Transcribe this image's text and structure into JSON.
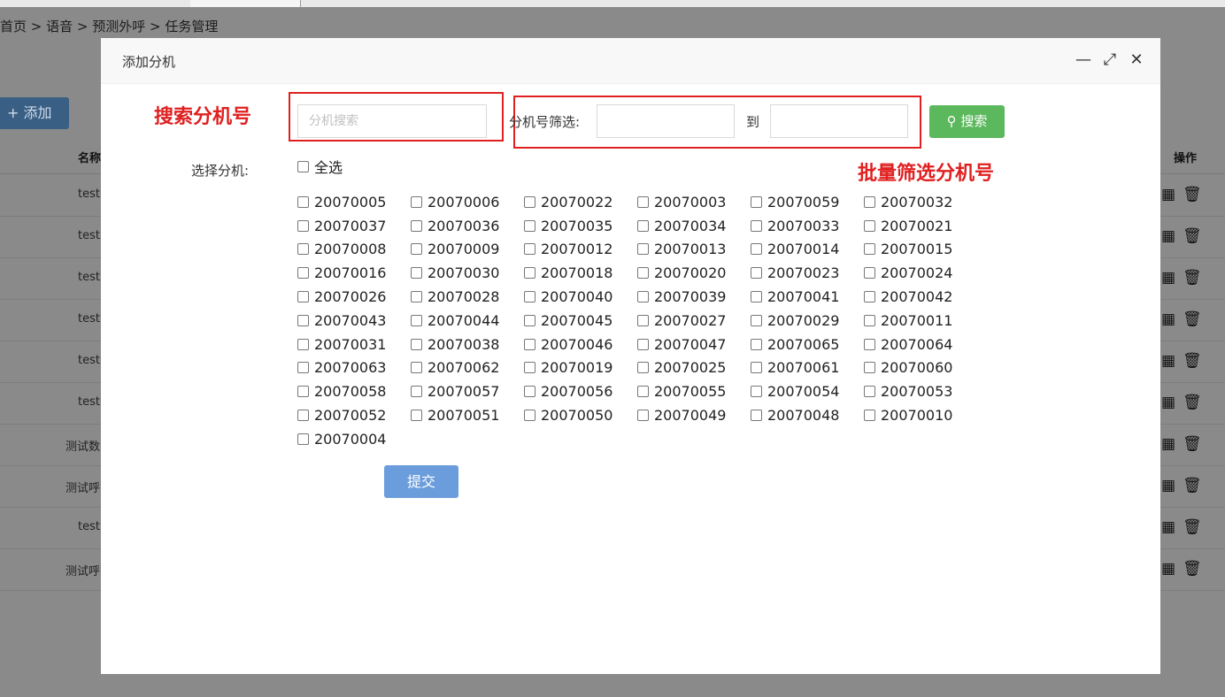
{
  "background": {
    "breadcrumb": "首页 > 语音 > 预测外呼 > 任务管理",
    "add_button": "+ 添加",
    "col_name": "名称",
    "col_operation": "操作",
    "rows": [
      "test",
      "test",
      "test",
      "test",
      "test",
      "test",
      "测试数",
      "测试呼",
      "test",
      "测试呼"
    ]
  },
  "modal": {
    "title": "添加分机",
    "annotation_search": "搜索分机号",
    "annotation_filter": "批量筛选分机号",
    "search_placeholder": "分机搜索",
    "filter_label": "分机号筛选:",
    "to_label": "到",
    "filter_from": "",
    "filter_to": "",
    "search_button": "搜索",
    "select_label": "选择分机:",
    "check_all": "全选",
    "extensions": [
      "20070005",
      "20070006",
      "20070022",
      "20070003",
      "20070059",
      "20070032",
      "20070037",
      "20070036",
      "20070035",
      "20070034",
      "20070033",
      "20070021",
      "20070008",
      "20070009",
      "20070012",
      "20070013",
      "20070014",
      "20070015",
      "20070016",
      "20070030",
      "20070018",
      "20070020",
      "20070023",
      "20070024",
      "20070026",
      "20070028",
      "20070040",
      "20070039",
      "20070041",
      "20070042",
      "20070043",
      "20070044",
      "20070045",
      "20070027",
      "20070029",
      "20070011",
      "20070031",
      "20070038",
      "20070046",
      "20070047",
      "20070065",
      "20070064",
      "20070063",
      "20070062",
      "20070019",
      "20070025",
      "20070061",
      "20070060",
      "20070058",
      "20070057",
      "20070056",
      "20070055",
      "20070054",
      "20070053",
      "20070052",
      "20070051",
      "20070050",
      "20070049",
      "20070048",
      "20070010",
      "20070004"
    ],
    "submit_button": "提交"
  },
  "colors": {
    "annotation": "#e02020",
    "search_button": "#5cb85c",
    "submit_button": "#6b9ddc"
  }
}
